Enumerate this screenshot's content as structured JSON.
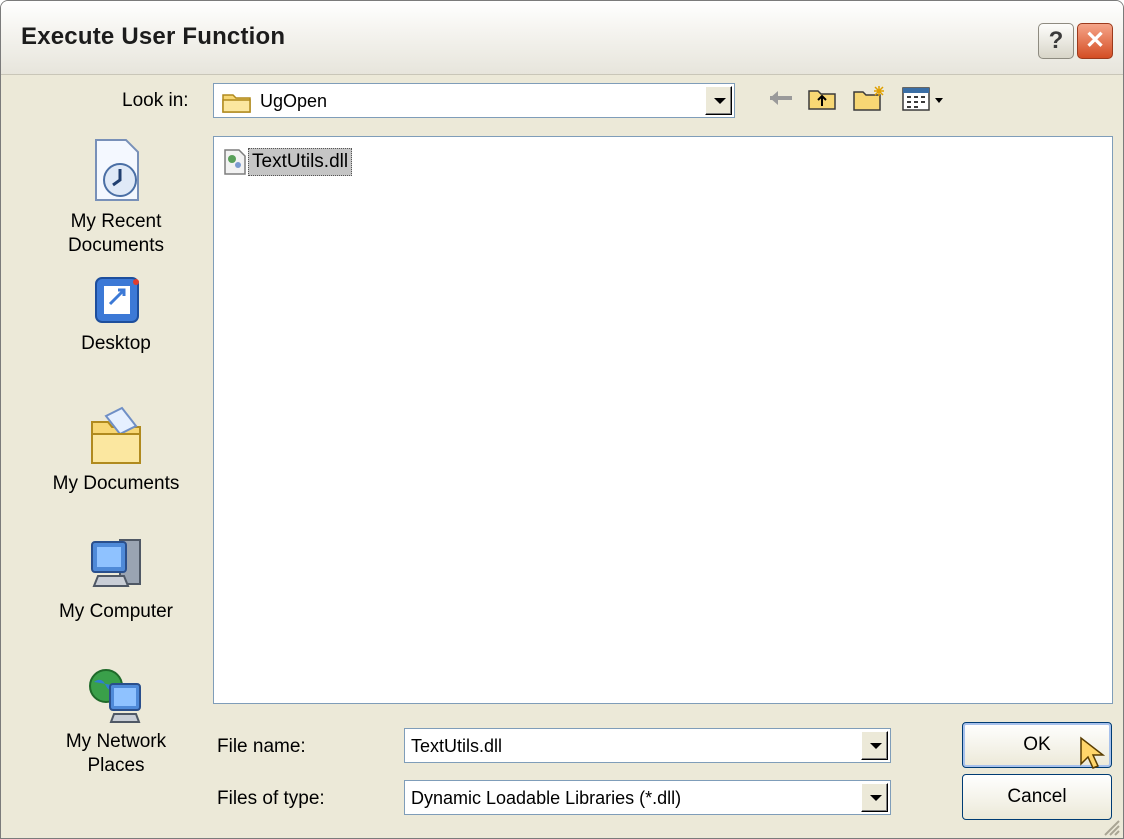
{
  "window": {
    "title": "Execute User Function"
  },
  "titlebar": {
    "help_label": "?",
    "close_label": "✕"
  },
  "look_in": {
    "label": "Look in:",
    "value": "UgOpen"
  },
  "places": [
    {
      "label_line1": "My Recent",
      "label_line2": "Documents",
      "icon": "recent-documents-icon"
    },
    {
      "label_line1": "Desktop",
      "label_line2": "",
      "icon": "desktop-icon"
    },
    {
      "label_line1": "My Documents",
      "label_line2": "",
      "icon": "my-documents-icon"
    },
    {
      "label_line1": "My Computer",
      "label_line2": "",
      "icon": "my-computer-icon"
    },
    {
      "label_line1": "My Network",
      "label_line2": "Places",
      "icon": "my-network-places-icon"
    }
  ],
  "files": [
    {
      "name": "TextUtils.dll",
      "icon": "dll-file-icon"
    }
  ],
  "file_name": {
    "label": "File name:",
    "value": "TextUtils.dll"
  },
  "file_type": {
    "label": "Files of type:",
    "value": "Dynamic Loadable Libraries (*.dll)"
  },
  "buttons": {
    "ok": "OK",
    "cancel": "Cancel"
  },
  "colors": {
    "accent": "#003c74",
    "window_bg": "#ece9d8",
    "close_red": "#d44d23"
  }
}
